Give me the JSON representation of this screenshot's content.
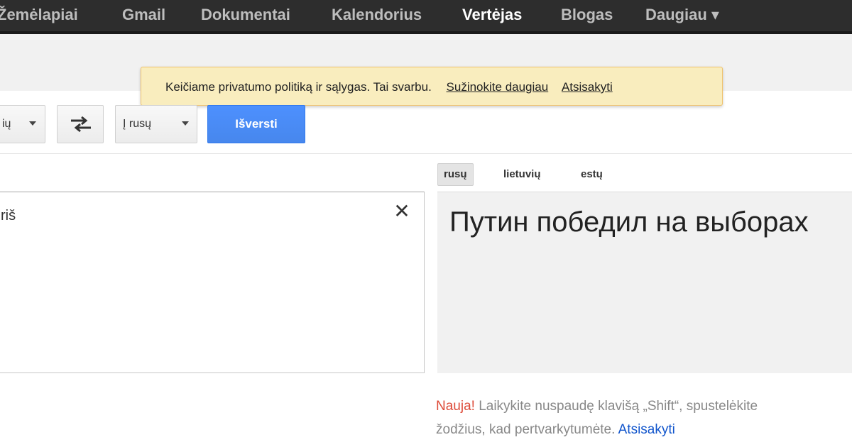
{
  "nav": {
    "items": [
      {
        "label": "Žemėlapiai",
        "active": false
      },
      {
        "label": "Gmail",
        "active": false
      },
      {
        "label": "Dokumentai",
        "active": false
      },
      {
        "label": "Kalendorius",
        "active": false
      },
      {
        "label": "Vertėjas",
        "active": true
      },
      {
        "label": "Blogas",
        "active": false
      },
      {
        "label": "Daugiau ▾",
        "active": false
      }
    ]
  },
  "notice": {
    "text": "Keičiame privatumo politiką ir sąlygas. Tai svarbu.",
    "learn_more": "Sužinokite daugiau",
    "dismiss": "Atsisakyti"
  },
  "controls": {
    "source_lang": "iš lietuvių",
    "source_lang_visible": "ių",
    "target_lang": "Į rusų",
    "translate_label": "Išversti",
    "swap_icon": "swap-arrows-icon",
    "translate_color": "#4d90fe"
  },
  "source": {
    "text_visible": "riš",
    "clear_icon": "close-icon"
  },
  "target": {
    "tabs": [
      {
        "label": "rusų",
        "selected": true
      },
      {
        "label": "lietuvių",
        "selected": false
      },
      {
        "label": "estų",
        "selected": false
      }
    ],
    "result": "Путин победил на выборах"
  },
  "tip": {
    "new_label": "Nauja!",
    "line1": "Laikykite nuspaudę klavišą „Shift“, spustelėkite",
    "line2": "žodžius, kad pertvarkytumėte.",
    "dismiss": "Atsisakyti"
  }
}
